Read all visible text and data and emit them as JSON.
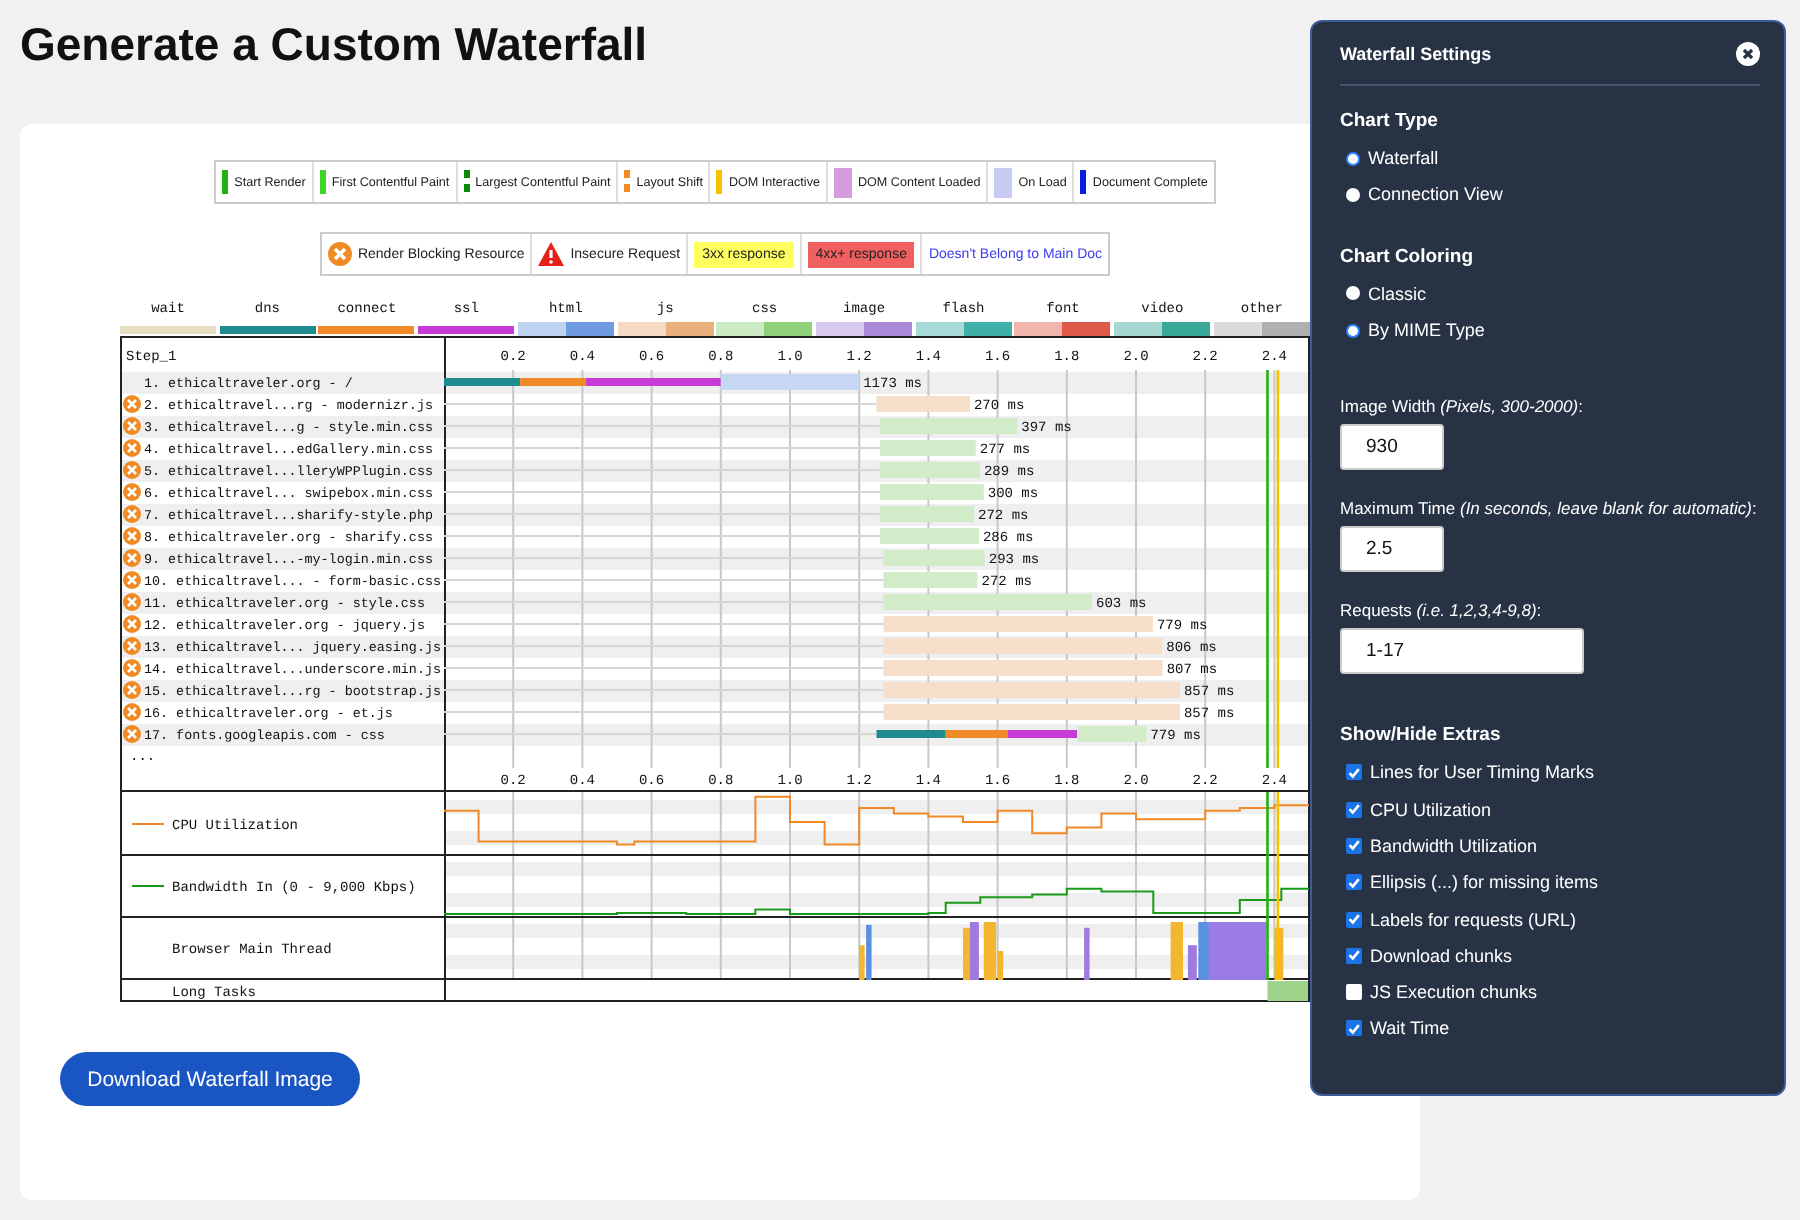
{
  "title": "Generate a Custom Waterfall",
  "legend": [
    {
      "kind": "bar",
      "label": "Start Render",
      "color": "#22b014"
    },
    {
      "kind": "bar",
      "label": "First Contentful Paint",
      "color": "#3fd42a"
    },
    {
      "kind": "dotted",
      "label": "Largest Contentful Paint",
      "color": "#0a8a0a"
    },
    {
      "kind": "dotted",
      "label": "Layout Shift",
      "color": "#f08a24"
    },
    {
      "kind": "bar",
      "label": "DOM Interactive",
      "color": "#f7c000"
    },
    {
      "kind": "box",
      "label": "DOM Content Loaded",
      "color": "#d79be0"
    },
    {
      "kind": "box",
      "label": "On Load",
      "color": "#c8ccf4"
    },
    {
      "kind": "bar",
      "label": "Document Complete",
      "color": "#0a1ee0"
    }
  ],
  "legend_flags": [
    {
      "kind": "blocking",
      "label": "Render Blocking Resource"
    },
    {
      "kind": "insecure",
      "label": "Insecure Request"
    },
    {
      "kind": "fill",
      "label": "3xx response",
      "color": "#ffff60"
    },
    {
      "kind": "fill",
      "label": "4xx+ response",
      "color": "#f06060"
    },
    {
      "kind": "link",
      "label": "Doesn't Belong to Main Doc",
      "color": "#3b3bf0"
    }
  ],
  "mime_key": [
    {
      "kind": "single",
      "name": "wait",
      "color": "#e6dcc0"
    },
    {
      "kind": "single",
      "name": "dns",
      "color": "#1f8a8f"
    },
    {
      "kind": "single",
      "name": "connect",
      "color": "#f08a24"
    },
    {
      "kind": "single",
      "name": "ssl",
      "color": "#c43bd6"
    },
    {
      "kind": "split",
      "name": "html",
      "color": "#6f9be0"
    },
    {
      "kind": "split",
      "name": "js",
      "color": "#e8b07a"
    },
    {
      "kind": "split",
      "name": "css",
      "color": "#8fd07a"
    },
    {
      "kind": "split",
      "name": "image",
      "color": "#a98ad8"
    },
    {
      "kind": "split",
      "name": "flash",
      "color": "#3fb0a8"
    },
    {
      "kind": "split",
      "name": "font",
      "color": "#e05a4a"
    },
    {
      "kind": "split",
      "name": "video",
      "color": "#3aa898"
    },
    {
      "kind": "split",
      "name": "other",
      "color": "#b0b0b0"
    }
  ],
  "waterfall": {
    "step": "Step_1",
    "ellipsis": "...",
    "rows": [
      {
        "blocking": false,
        "duration": "1173 ms"
      },
      {
        "blocking": true,
        "duration": "270 ms"
      },
      {
        "blocking": true,
        "duration": "397 ms"
      },
      {
        "blocking": true,
        "duration": "277 ms"
      },
      {
        "blocking": true,
        "duration": "289 ms"
      },
      {
        "blocking": true,
        "duration": "300 ms"
      },
      {
        "blocking": true,
        "duration": "272 ms"
      },
      {
        "blocking": true,
        "duration": "286 ms"
      },
      {
        "blocking": true,
        "duration": "293 ms"
      },
      {
        "blocking": true,
        "duration": "272 ms"
      },
      {
        "blocking": true,
        "duration": "603 ms"
      },
      {
        "blocking": true,
        "duration": "779 ms"
      },
      {
        "blocking": true,
        "duration": "806 ms"
      },
      {
        "blocking": true,
        "duration": "807 ms"
      },
      {
        "blocking": true,
        "duration": "857 ms"
      },
      {
        "blocking": true,
        "duration": "857 ms"
      },
      {
        "blocking": true,
        "duration": "779 ms"
      }
    ],
    "bottom_ticks": [
      "0.2",
      "0.4",
      "0.6",
      "0.8",
      "1.0",
      "1.2",
      "1.4",
      "1.6",
      "1.8",
      "2.0",
      "2.2",
      "2.4"
    ],
    "chart_data": {
      "type": "bar",
      "orientation": "horizontal",
      "stacked": true,
      "grid": true,
      "xlim": [
        0,
        2.5
      ],
      "xticks": [
        0.2,
        0.4,
        0.6,
        0.8,
        {
          "value": 1,
          "label": "1.0"
        },
        1.2,
        1.4,
        1.6,
        1.8,
        {
          "value": 2,
          "label": "2.0"
        },
        2.2,
        2.4
      ],
      "categories": [
        "1. ethicaltraveler.org - /",
        "2. ethicaltravel...rg - modernizr.js",
        "3. ethicaltravel...g - style.min.css",
        "4. ethicaltravel...edGallery.min.css",
        "5. ethicaltravel...lleryWPPlugin.css",
        "6. ethicaltravel... swipebox.min.css",
        "7. ethicaltravel...sharify-style.php",
        "8. ethicaltraveler.org - sharify.css",
        "9. ethicaltravel...-my-login.min.css",
        "10. ethicaltravel... - form-basic.css",
        "11. ethicaltraveler.org - style.css",
        "12. ethicaltraveler.org - jquery.js",
        "13. ethicaltravel... jquery.easing.js",
        "14. ethicaltravel...underscore.min.js",
        "15. ethicaltravel...rg - bootstrap.js",
        "16. ethicaltraveler.org - et.js",
        "17. fonts.googleapis.com - css"
      ],
      "series": [
        {
          "values": [
            0,
            1.25,
            1.26,
            1.26,
            1.26,
            1.26,
            1.26,
            1.26,
            1.27,
            1.27,
            1.27,
            1.27,
            1.27,
            1.27,
            1.27,
            1.27,
            1.25
          ]
        },
        {
          "color": "#1f8a8f",
          "values": [
            0.22,
            0,
            0,
            0,
            0,
            0,
            0,
            0,
            0,
            0,
            0,
            0,
            0,
            0,
            0,
            0,
            0.2
          ]
        },
        {
          "color": "#f08a24",
          "values": [
            0.19,
            0,
            0,
            0,
            0,
            0,
            0,
            0,
            0,
            0,
            0,
            0,
            0,
            0,
            0,
            0,
            0.18
          ]
        },
        {
          "color": "#c43bd6",
          "values": [
            0.39,
            0,
            0,
            0,
            0,
            0,
            0,
            0,
            0,
            0,
            0,
            0,
            0,
            0,
            0,
            0,
            0.2
          ]
        },
        {
          "colors": [
            "#c5d7f3",
            "#f6dfca",
            "#d2ecc9",
            "#d2ecc9",
            "#d2ecc9",
            "#d2ecc9",
            "#d2ecc9",
            "#d2ecc9",
            "#d2ecc9",
            "#d2ecc9",
            "#d2ecc9",
            "#f6dfca",
            "#f6dfca",
            "#f6dfca",
            "#f6dfca",
            "#f6dfca",
            "#d2ecc9"
          ],
          "values": [
            0.4,
            0.27,
            0.397,
            0.277,
            0.289,
            0.3,
            0.272,
            0.286,
            0.293,
            0.272,
            0.603,
            0.779,
            0.806,
            0.807,
            0.857,
            0.857,
            0.2
          ]
        }
      ],
      "ref_lines": [
        {
          "axis": "x",
          "value": 2.38,
          "color": "#22b014"
        },
        {
          "axis": "x",
          "value": 2.41,
          "color": "#f7c000"
        }
      ]
    },
    "graphs": [
      {
        "kind": "cpu",
        "label": "CPU Utilization"
      },
      {
        "kind": "bandwidth",
        "label": "Bandwidth In (0 - 9,000 Kbps)"
      },
      {
        "kind": "main_thread",
        "label": "Browser Main Thread"
      },
      {
        "kind": "long_tasks",
        "label": "Long Tasks"
      }
    ]
  },
  "download_button": "Download Waterfall Image",
  "settings": {
    "title": "Waterfall Settings",
    "sections": [
      {
        "kind": "radios",
        "heading": "Chart Type",
        "options": [
          {
            "label": "Waterfall",
            "selected": true
          },
          {
            "label": "Connection View",
            "selected": false
          }
        ]
      },
      {
        "kind": "radios",
        "heading": "Chart Coloring",
        "options": [
          {
            "label": "Classic",
            "selected": false
          },
          {
            "label": "By MIME Type",
            "selected": true
          }
        ]
      },
      {
        "kind": "number",
        "label": "Image Width *(Pixels, 300-2000)*:",
        "value": "930"
      },
      {
        "kind": "number",
        "label": "Maximum Time *(In seconds, leave blank for automatic)*:",
        "value": "2.5"
      },
      {
        "kind": "text",
        "label": "Requests *(i.e. 1,2,3,4-9,8)*:",
        "value": "1-17"
      },
      {
        "kind": "checks",
        "heading": "Show/Hide Extras",
        "options": [
          {
            "label": "Lines for User Timing Marks",
            "checked": true
          },
          {
            "label": "CPU Utilization",
            "checked": true
          },
          {
            "label": "Bandwidth Utilization",
            "checked": true
          },
          {
            "label": "Ellipsis (...) for missing items",
            "checked": true
          },
          {
            "label": "Labels for requests (URL)",
            "checked": true
          },
          {
            "label": "Download chunks",
            "checked": true
          },
          {
            "label": "JS Execution chunks",
            "checked": false
          },
          {
            "label": "Wait Time",
            "checked": true
          }
        ]
      }
    ]
  }
}
